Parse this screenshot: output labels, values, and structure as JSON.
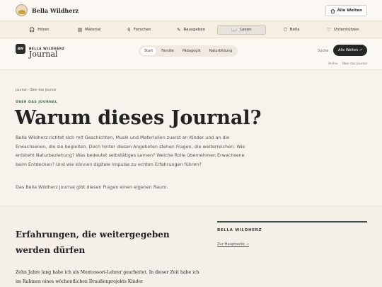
{
  "top_header": {
    "brand_name": "Bella Wildherz",
    "all_worlds_label": "Alle Welten"
  },
  "main_nav": {
    "items": [
      {
        "label": "Hören",
        "icon": "headphones-icon",
        "glyph": "🎧"
      },
      {
        "label": "Material",
        "icon": "document-icon",
        "glyph": "▤"
      },
      {
        "label": "Forschen",
        "icon": "magnifier-icon",
        "glyph": "⚲"
      },
      {
        "label": "Rausgeben",
        "icon": "pencil-icon",
        "glyph": "✎"
      },
      {
        "label": "Lesen",
        "icon": "book-icon",
        "glyph": "📖"
      },
      {
        "label": "Bella",
        "icon": "shield-icon",
        "glyph": "⛉"
      },
      {
        "label": "Unterstützen",
        "icon": "heart-icon",
        "glyph": "♡"
      }
    ],
    "active": "Lesen"
  },
  "journal_bar": {
    "badge": "BW",
    "kicker": "BELLA WILDHERZ",
    "title": "Journal",
    "pills": [
      "Start",
      "Familie",
      "Pädagogik",
      "Naturbildung"
    ],
    "active_pill": "Start",
    "search_label": "Suche",
    "all_worlds_label": "Alle Welten ↗",
    "sub_links": [
      "Archiv",
      "Über das Journal"
    ]
  },
  "intro": {
    "breadcrumb": "Journal › Über das Journal",
    "kicker": "ÜBER DAS JOURNAL",
    "title": "Warum dieses Journal?",
    "lead": "Bella Wildherz richtet sich mit Geschichten, Musik und Materialien zuerst an Kinder und an die Erwachsenen, die sie begleiten. Doch hinter diesen Angeboten stehen Fragen, die weiterreichen: Wie entsteht Naturbeziehung? Was bedeutet selbstätiges Lernen? Welche Rolle übernehmen Erwachsene beim Entdecken? Und wie können digitale Impulse zu echten Erfahrungen führen?",
    "lead2": "Das Bella Wildherz Journal gibt diesen Fragen einen eigenen Raum."
  },
  "lower": {
    "heading": "Erfahrungen, die weitergegeben werden dürfen",
    "body": "Zehn Jahre lang habe ich als Montessori-Lehrer gearbeitet. In dieser Zeit habe ich im Rahmen eines wöchentlichen Draußenprojekts Kinder",
    "side_title": "BELLA WILDHERZ",
    "side_link": "Zur Hauptseite →"
  },
  "colors": {
    "accent_green": "#3e6b4a",
    "dark_button": "#262626",
    "background": "#f7f3ec"
  }
}
